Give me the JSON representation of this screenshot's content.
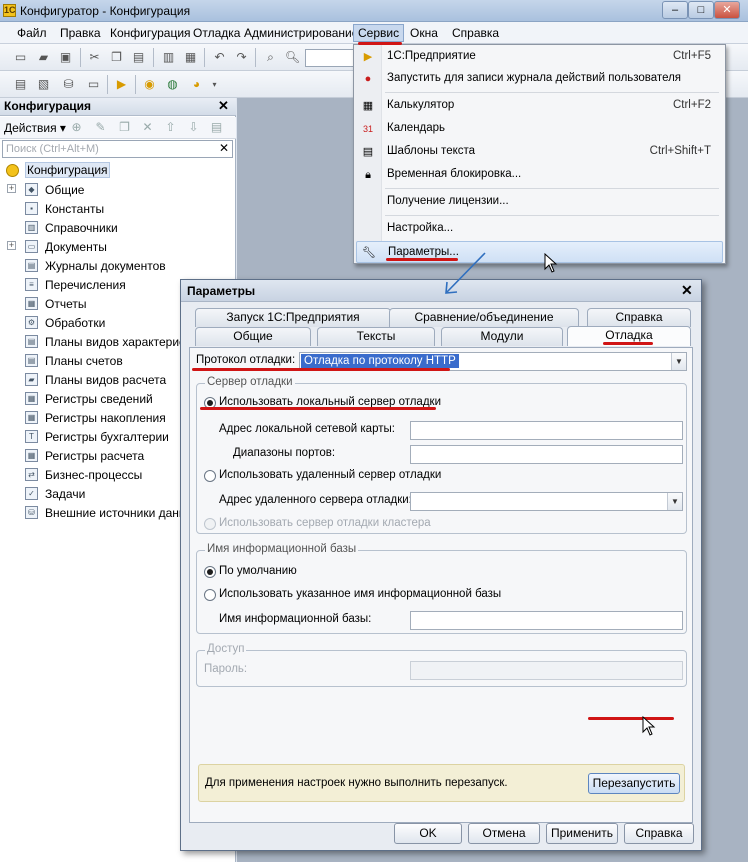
{
  "window": {
    "title": "Конфигуратор - Конфигурация",
    "logo": "1С",
    "min": "–",
    "max": "□",
    "close": "✕"
  },
  "menu": [
    "Файл",
    "Правка",
    "Конфигурация",
    "Отладка",
    "Администрирование",
    "Сервис",
    "Окна",
    "Справка"
  ],
  "panel": {
    "title": "Конфигурация",
    "actions": "Действия ▾",
    "search_placeholder": "Поиск (Ctrl+Alt+M)",
    "close": "✕"
  },
  "tree": {
    "root": "Конфигурация",
    "items": [
      "Общие",
      "Константы",
      "Справочники",
      "Документы",
      "Журналы документов",
      "Перечисления",
      "Отчеты",
      "Обработки",
      "Планы видов характерист",
      "Планы счетов",
      "Планы видов расчета",
      "Регистры сведений",
      "Регистры накопления",
      "Регистры бухгалтерии",
      "Регистры расчета",
      "Бизнес-процессы",
      "Задачи",
      "Внешние источники данны"
    ]
  },
  "service_menu": {
    "items": [
      {
        "label": "1С:Предприятие",
        "shortcut": "Ctrl+F5",
        "icon": "play-icon"
      },
      {
        "label": "Запустить для записи журнала действий пользователя",
        "shortcut": "",
        "icon": "record-icon"
      },
      {
        "label": "Калькулятор",
        "shortcut": "Ctrl+F2",
        "icon": "calculator-icon"
      },
      {
        "label": "Календарь",
        "shortcut": "",
        "icon": "calendar-icon"
      },
      {
        "label": "Шаблоны текста",
        "shortcut": "Ctrl+Shift+T",
        "icon": "template-icon"
      },
      {
        "label": "Временная блокировка...",
        "shortcut": "",
        "icon": "lock-icon"
      },
      {
        "label": "Получение лицензии...",
        "shortcut": "",
        "icon": ""
      },
      {
        "label": "Настройка...",
        "shortcut": "",
        "icon": ""
      },
      {
        "label": "Параметры...",
        "shortcut": "",
        "icon": "wrench-icon"
      }
    ]
  },
  "dialog": {
    "title": "Параметры",
    "close": "✕",
    "tabs_row1": [
      "Запуск 1С:Предприятия",
      "Сравнение/объединение",
      "Справка"
    ],
    "tabs_row2": [
      "Общие",
      "Тексты",
      "Модули",
      "Отладка"
    ],
    "protocol_label": "Протокол отладки:",
    "protocol_value": "Отладка по протоколу HTTP",
    "debug_server": {
      "legend": "Сервер отладки",
      "local": "Использовать локальный сервер отладки",
      "net_card": "Адрес локальной сетевой карты:",
      "ports": "Диапазоны портов:",
      "remote": "Использовать удаленный сервер отладки",
      "remote_addr": "Адрес удаленного сервера отладки:",
      "cluster": "Использовать сервер отладки кластера"
    },
    "infobase": {
      "legend": "Имя информационной базы",
      "default": "По умолчанию",
      "custom": "Использовать указанное имя информационной базы",
      "name_label": "Имя информационной базы:"
    },
    "access": {
      "legend": "Доступ",
      "password": "Пароль:"
    },
    "restart_text": "Для применения настроек нужно выполнить перезапуск.",
    "restart_button": "Перезапустить",
    "buttons": {
      "ok": "OK",
      "cancel": "Отмена",
      "apply": "Применить",
      "help": "Справка"
    }
  },
  "colors": {
    "annotation_red": "#d01515",
    "arrow_blue": "#2f6fbf"
  }
}
